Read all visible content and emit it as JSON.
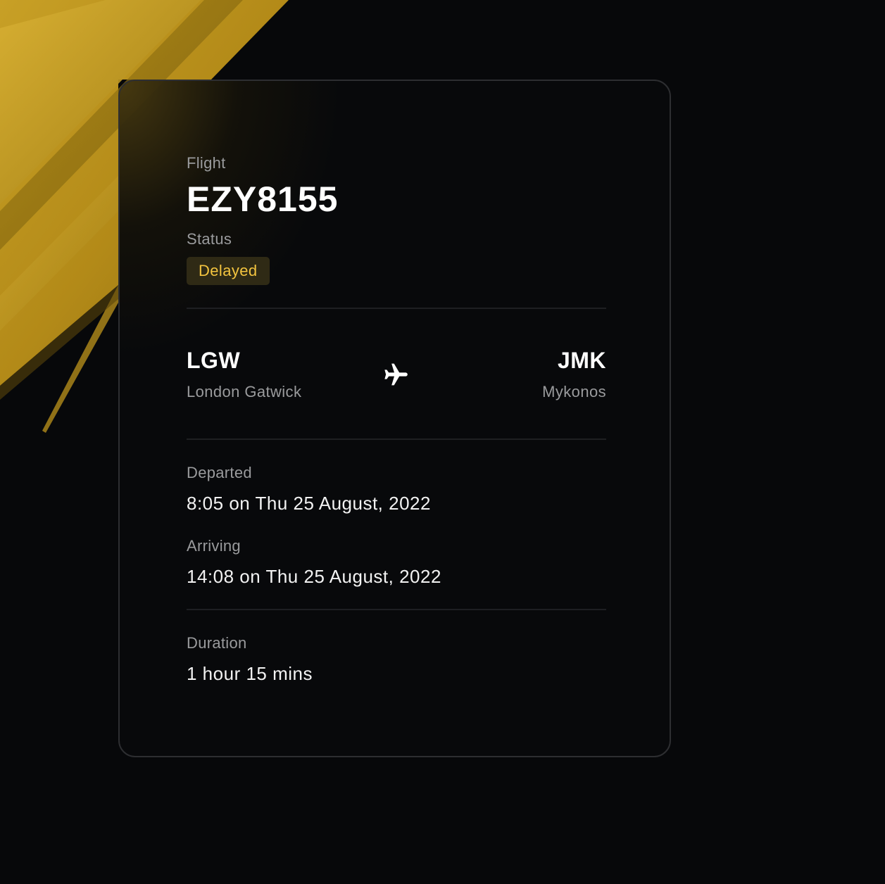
{
  "flight": {
    "label": "Flight",
    "number": "EZY8155"
  },
  "status": {
    "label": "Status",
    "value": "Delayed",
    "badge_color": "#f3c43f"
  },
  "route": {
    "origin": {
      "code": "LGW",
      "name": "London Gatwick"
    },
    "destination": {
      "code": "JMK",
      "name": "Mykonos"
    },
    "icon": "airplane-icon"
  },
  "times": {
    "departed_label": "Departed",
    "departed_value": "8:05 on Thu 25 August, 2022",
    "arriving_label": "Arriving",
    "arriving_value": "14:08 on Thu 25 August, 2022"
  },
  "duration": {
    "label": "Duration",
    "value": "1 hour 15 mins"
  },
  "colors": {
    "background": "#07080a",
    "accent_gold": "#c9a227",
    "card_border": "#2d2e31"
  }
}
